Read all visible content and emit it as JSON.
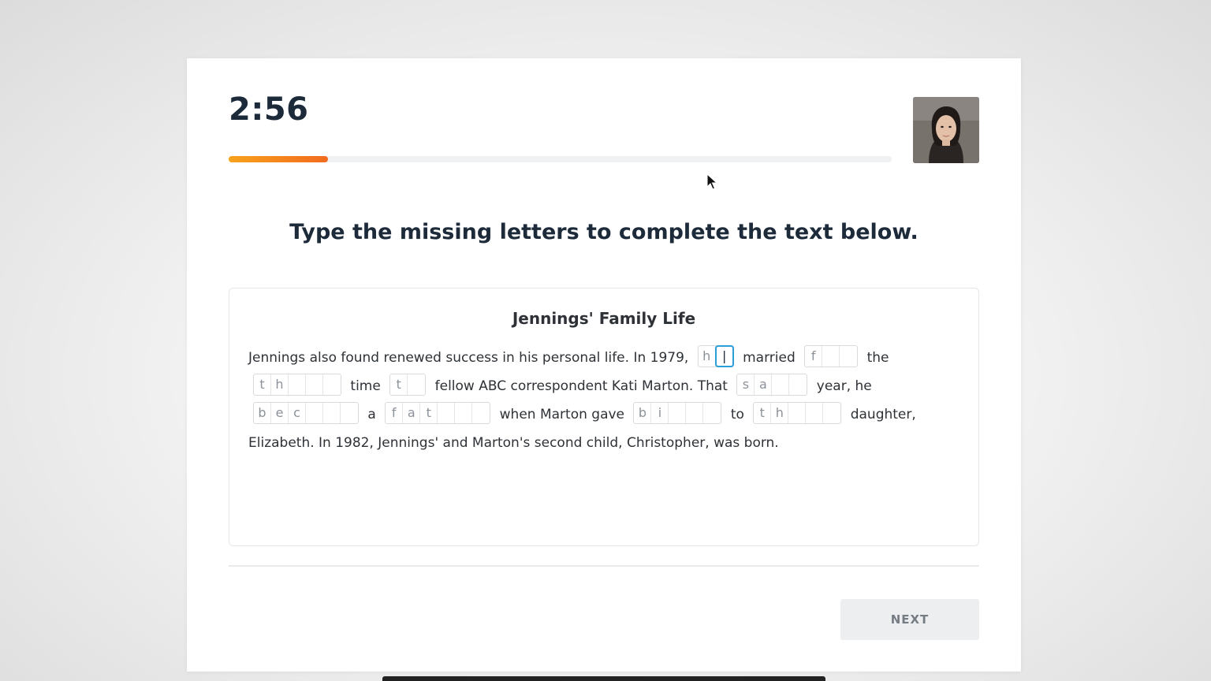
{
  "timer": "2:56",
  "progress": 0.15,
  "instruction": "Type the missing letters to complete the text below.",
  "passage": {
    "title": "Jennings' Family Life",
    "line1": {
      "t1": "Jennings also found renewed success in his personal life. In 1979,",
      "g1": [
        "h",
        ""
      ],
      "t2": "married",
      "g2": [
        "f",
        "",
        ""
      ],
      "t3": "the"
    },
    "line2": {
      "g1": [
        "t",
        "h",
        "",
        "",
        ""
      ],
      "t1": "time",
      "g2": [
        "t",
        ""
      ],
      "t2": "fellow ABC correspondent Kati Marton. That",
      "g3": [
        "s",
        "a",
        "",
        ""
      ],
      "t3": "year, he"
    },
    "line3": {
      "g1": [
        "b",
        "e",
        "c",
        "",
        "",
        ""
      ],
      "t1": "a",
      "g2": [
        "f",
        "a",
        "t",
        "",
        "",
        ""
      ],
      "t2": "when Marton gave",
      "g3": [
        "b",
        "i",
        "",
        "",
        ""
      ],
      "t3": "to",
      "g4": [
        "t",
        "h",
        "",
        "",
        ""
      ],
      "t4": "daughter,"
    },
    "line4": "Elizabeth. In 1982, Jennings' and Marton's second child, Christopher, was born."
  },
  "next_label": "NEXT",
  "colors": {
    "progress_start": "#f7a21b",
    "progress_end": "#f26b1f",
    "active_input": "#2a9fd8",
    "title_text": "#1c2a3a"
  }
}
